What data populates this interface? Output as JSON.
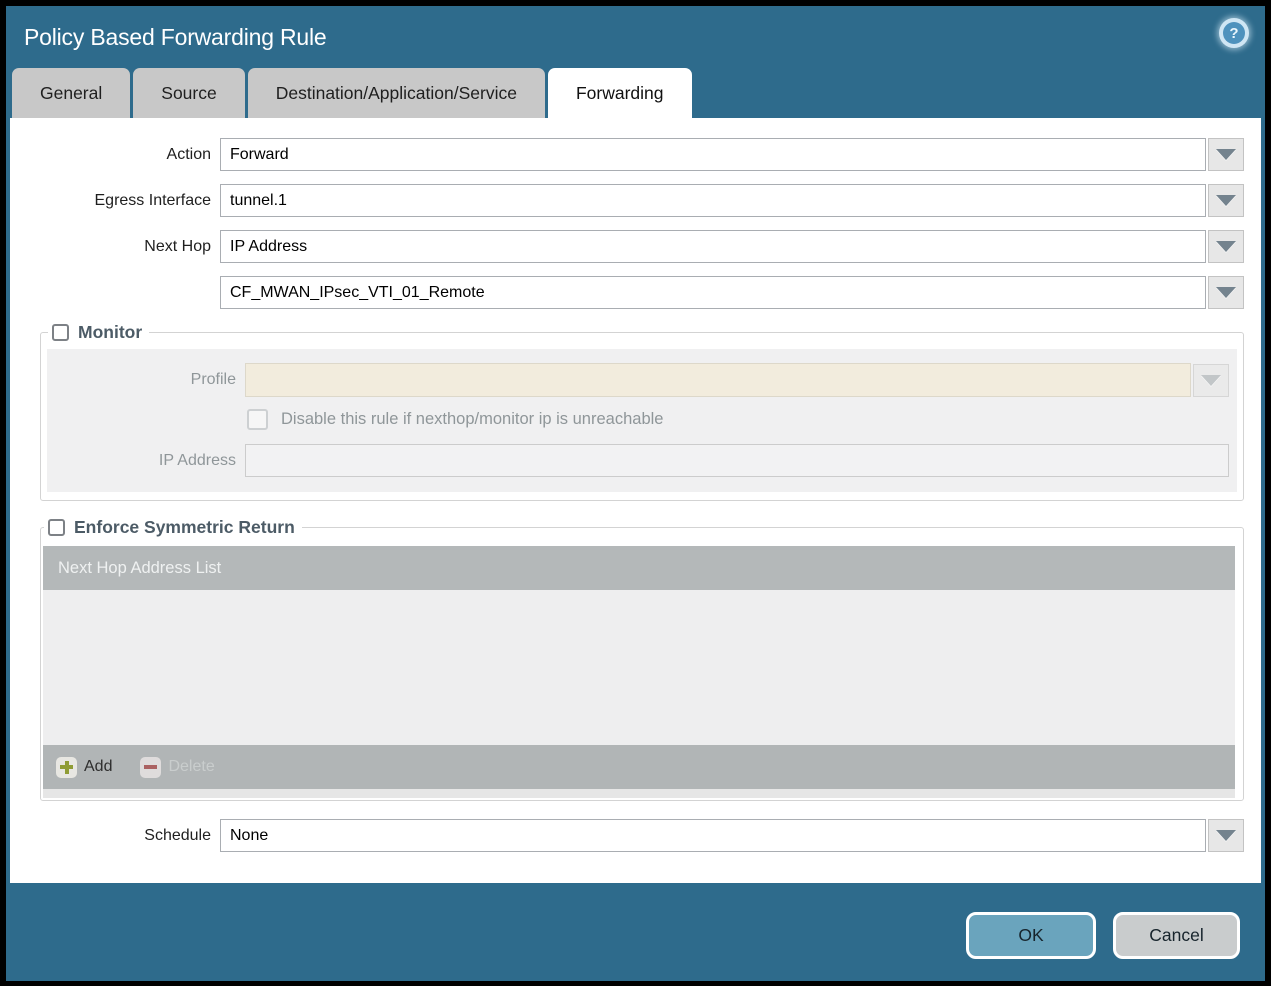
{
  "window": {
    "title": "Policy Based Forwarding Rule"
  },
  "tabs": [
    {
      "label": "General",
      "active": false
    },
    {
      "label": "Source",
      "active": false
    },
    {
      "label": "Destination/Application/Service",
      "active": false
    },
    {
      "label": "Forwarding",
      "active": true
    }
  ],
  "form": {
    "action_label": "Action",
    "action_value": "Forward",
    "egress_label": "Egress Interface",
    "egress_value": "tunnel.1",
    "next_hop_label": "Next Hop",
    "next_hop_value": "IP Address",
    "next_hop_address_value": "CF_MWAN_IPsec_VTI_01_Remote",
    "schedule_label": "Schedule",
    "schedule_value": "None"
  },
  "monitor": {
    "legend": "Monitor",
    "checked": false,
    "profile_label": "Profile",
    "profile_value": "",
    "disable_rule_label": "Disable this rule if nexthop/monitor ip is unreachable",
    "disable_rule_checked": false,
    "ip_address_label": "IP Address",
    "ip_address_value": ""
  },
  "symmetric_return": {
    "legend": "Enforce Symmetric Return",
    "checked": false,
    "table_header": "Next Hop Address List",
    "rows": [],
    "add_label": "Add",
    "delete_label": "Delete"
  },
  "footer": {
    "ok_label": "OK",
    "cancel_label": "Cancel"
  },
  "help_glyph": "?",
  "colors": {
    "titlebar_teal": "#2e6b8c",
    "ok_button_teal": "#6aa4bd",
    "cancel_button_gray": "#c9cccd",
    "disabled_field_beige": "#f2ecdd",
    "panel_gray": "#f0f0f1",
    "table_header_gray": "#b4b8b9"
  }
}
